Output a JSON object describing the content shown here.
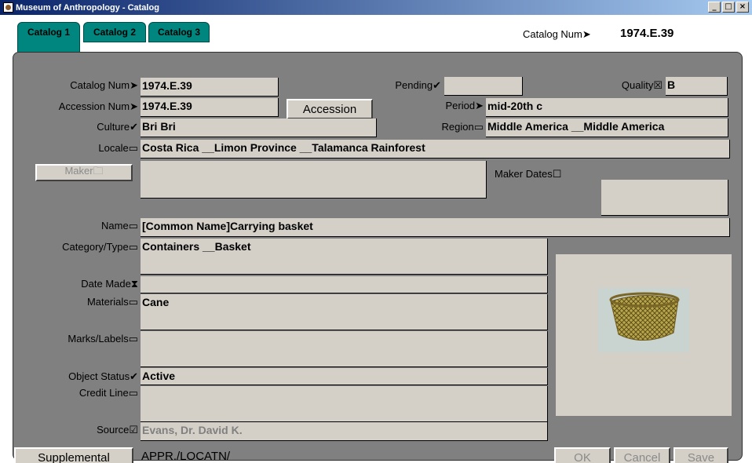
{
  "window": {
    "title": "Museum of Anthropology - Catalog",
    "min": "_",
    "max": "□",
    "close": "×"
  },
  "tabs": [
    "Catalog 1",
    "Catalog 2",
    "Catalog 3"
  ],
  "header": {
    "catalog_num_label": "Catalog Num➤",
    "catalog_num_value": "1974.E.39"
  },
  "form": {
    "catalog_num_label": "Catalog Num➤",
    "catalog_num": "1974.E.39",
    "pending_label": "Pending✔",
    "pending": "",
    "quality_label": "Quality☒",
    "quality": "B",
    "accession_num_label": "Accession Num➤",
    "accession_num": "1974.E.39",
    "accession_button": "Accession",
    "period_label": "Period➤",
    "period": "mid-20th c",
    "culture_label": "Culture✔",
    "culture": "Bri Bri",
    "region_label": "Region▭",
    "region": "Middle America __Middle America",
    "locale_label": "Locale▭",
    "locale": "Costa Rica __Limon Province __Talamanca Rainforest",
    "maker_button": "Maker🗀",
    "maker": "",
    "maker_dates_label": "Maker Dates☐",
    "maker_dates": "",
    "name_label": "Name▭",
    "name": "[Common Name]Carrying basket",
    "category_label": "Category/Type▭",
    "category": "Containers __Basket",
    "date_made_label": "Date Made⧗",
    "date_made": "",
    "materials_label": "Materials▭",
    "materials": "Cane",
    "marks_label": "Marks/Labels▭",
    "marks": "",
    "status_label": "Object Status✔",
    "status": "Active",
    "credit_label": "Credit Line▭",
    "credit": "",
    "source_label": "Source☑",
    "source": "Evans, Dr. David K."
  },
  "footer": {
    "supplemental_button": "Supplemental",
    "appr_text": "APPR./LOCATN/",
    "ok_button": "OK",
    "cancel_button": "Cancel",
    "save_button": "Save"
  }
}
